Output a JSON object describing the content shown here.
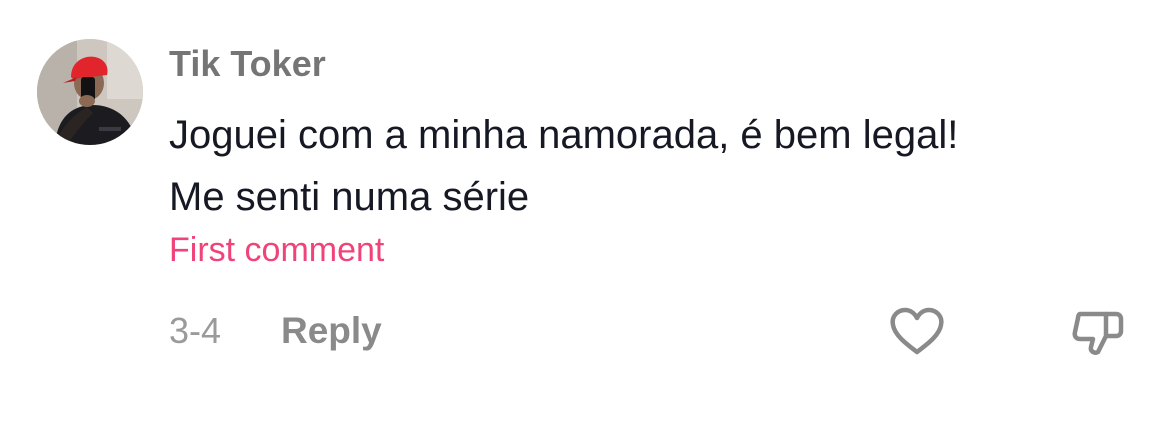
{
  "comment": {
    "author": "Tik Toker",
    "text_lines": [
      "Joguei com a minha namorada, é bem legal!",
      "Me senti numa série"
    ],
    "badge": "First comment",
    "date": "3-4",
    "reply_label": "Reply",
    "avatar_icon": "user-avatar-photo",
    "like_icon": "heart-outline-icon",
    "dislike_icon": "thumbs-down-outline-icon"
  },
  "colors": {
    "author": "#757575",
    "text": "#161823",
    "badge": "#f0437a",
    "meta": "#9a9a9a",
    "icon": "#8a8a8a"
  }
}
